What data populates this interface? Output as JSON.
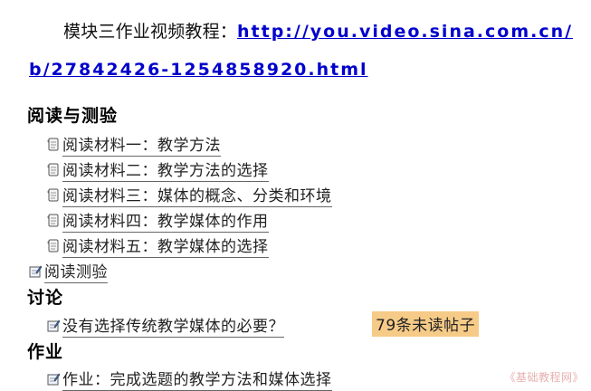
{
  "tutorial": {
    "label": "模块三作业视频教程：",
    "link_text": "http://you.video.sina.com.cn/b/27842426-1254858920.html"
  },
  "sections": {
    "reading": {
      "title": "阅读与测验",
      "materials": [
        "阅读材料一：教学方法",
        "阅读材料二：教学方法的选择",
        "阅读材料三：媒体的概念、分类和环境",
        "阅读材料四：教学媒体的作用",
        "阅读材料五：教学媒体的选择"
      ],
      "quiz": "阅读测验"
    },
    "discussion": {
      "title": "讨论",
      "topic": "没有选择传统教学媒体的必要？",
      "unread": "79条未读帖子"
    },
    "homework": {
      "title": "作业",
      "assignment": "作业：完成选题的教学方法和媒体选择"
    }
  },
  "watermark": "《基础教程网》",
  "icons": {
    "material": "document-icon",
    "quiz": "quiz-icon",
    "forum": "forum-icon",
    "assignment": "assignment-icon"
  }
}
